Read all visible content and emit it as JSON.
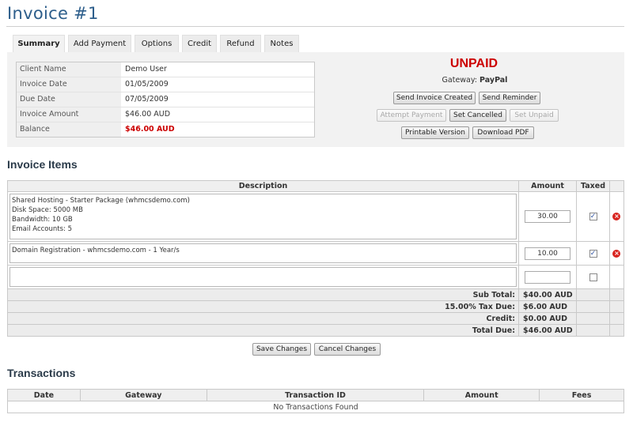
{
  "page": {
    "title": "Invoice #1"
  },
  "tabs": [
    {
      "label": "Summary",
      "active": true
    },
    {
      "label": "Add Payment"
    },
    {
      "label": "Options"
    },
    {
      "label": "Credit"
    },
    {
      "label": "Refund"
    },
    {
      "label": "Notes"
    }
  ],
  "summary": {
    "rows": [
      {
        "label": "Client Name",
        "value": "Demo User"
      },
      {
        "label": "Invoice Date",
        "value": "01/05/2009"
      },
      {
        "label": "Due Date",
        "value": "07/05/2009"
      },
      {
        "label": "Invoice Amount",
        "value": "$46.00 AUD"
      },
      {
        "label": "Balance",
        "value": "$46.00 AUD"
      }
    ],
    "status": "UNPAID",
    "gateway_label": "Gateway:",
    "gateway_value": "PayPal",
    "buttons": {
      "send_invoice_created": "Send Invoice Created",
      "send_reminder": "Send Reminder",
      "attempt_payment": "Attempt Payment",
      "set_cancelled": "Set Cancelled",
      "set_unpaid": "Set Unpaid",
      "printable_version": "Printable Version",
      "download_pdf": "Download PDF"
    }
  },
  "items_section": {
    "heading": "Invoice Items",
    "columns": {
      "description": "Description",
      "amount": "Amount",
      "taxed": "Taxed"
    },
    "rows": [
      {
        "description": "Shared Hosting - Starter Package (whmcsdemo.com)\nDisk Space: 5000 MB\nBandwidth: 10 GB\nEmail Accounts: 5",
        "amount": "30.00",
        "taxed": true
      },
      {
        "description": "Domain Registration - whmcsdemo.com - 1 Year/s",
        "amount": "10.00",
        "taxed": true
      },
      {
        "description": "",
        "amount": "",
        "taxed": false
      }
    ],
    "totals": [
      {
        "label": "Sub Total:",
        "value": "$40.00 AUD"
      },
      {
        "label": "15.00% Tax Due:",
        "value": "$6.00 AUD"
      },
      {
        "label": "Credit:",
        "value": "$0.00 AUD"
      },
      {
        "label": "Total Due:",
        "value": "$46.00 AUD"
      }
    ],
    "save_label": "Save Changes",
    "cancel_label": "Cancel Changes"
  },
  "transactions": {
    "heading": "Transactions",
    "columns": [
      "Date",
      "Gateway",
      "Transaction ID",
      "Amount",
      "Fees"
    ],
    "empty_text": "No Transactions Found"
  },
  "colors": {
    "title": "#2d5e8b",
    "status": "#cc0000",
    "balance": "#cc0000",
    "delete": "#d8241f"
  },
  "icons": {
    "delete": "delete-icon",
    "checkbox": "checkbox-checked-icon"
  }
}
